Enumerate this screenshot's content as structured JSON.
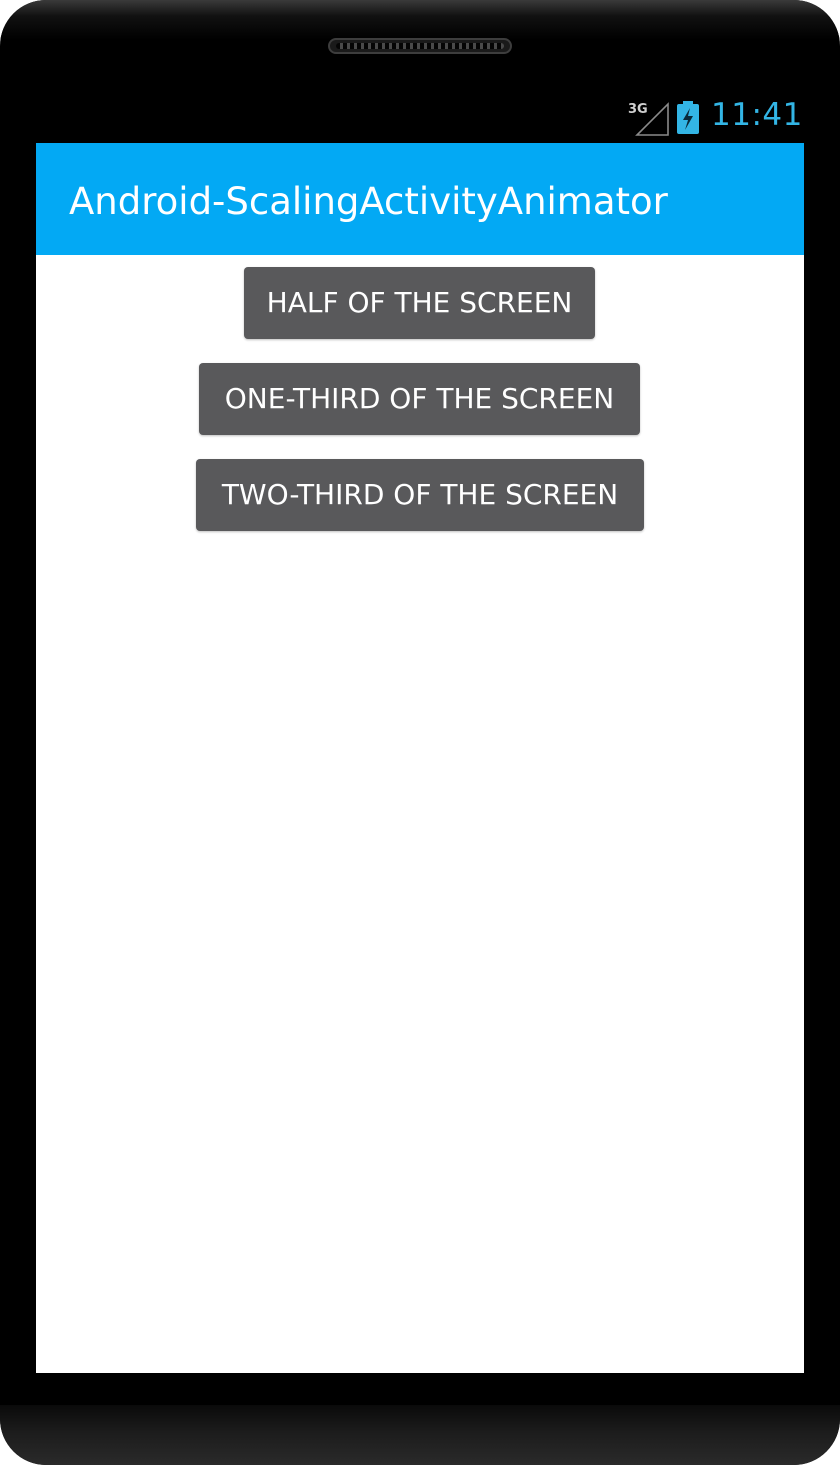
{
  "status_bar": {
    "network_label": "3G",
    "time": "11:41",
    "clock_color": "#33b5e5",
    "signal_icon": "cell-signal-icon",
    "battery_icon": "battery-charging-icon"
  },
  "action_bar": {
    "title": "Android-ScalingActivityAnimator",
    "background_color": "#03a9f4"
  },
  "buttons": [
    {
      "label": "HALF OF THE SCREEN"
    },
    {
      "label": "ONE-THIRD OF THE SCREEN"
    },
    {
      "label": "TWO-THIRD OF THE SCREEN"
    }
  ],
  "colors": {
    "button_background": "#59595b",
    "button_text": "#ffffff",
    "device_frame": "#000000",
    "screen_background": "#ffffff"
  }
}
